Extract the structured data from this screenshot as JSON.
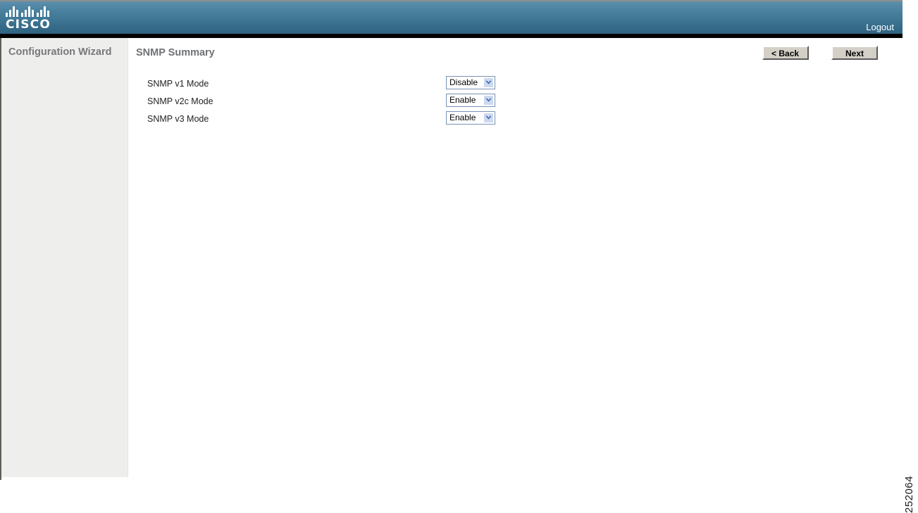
{
  "header": {
    "brand": "CISCO",
    "brand_logo_icon": "cisco-bars-icon",
    "logout_label": "Logout"
  },
  "sidebar": {
    "title": "Configuration Wizard"
  },
  "main": {
    "page_title": "SNMP Summary",
    "buttons": {
      "back_label": "< Back",
      "next_label": "Next"
    },
    "rows": [
      {
        "label": "SNMP v1 Mode",
        "value": "Disable",
        "arrow_icon": "chevron-down-icon"
      },
      {
        "label": "SNMP v2c Mode",
        "value": "Enable",
        "arrow_icon": "chevron-down-icon"
      },
      {
        "label": "SNMP v3 Mode",
        "value": "Enable",
        "arrow_icon": "chevron-down-icon"
      }
    ],
    "select_options": [
      "Enable",
      "Disable"
    ]
  },
  "watermark": {
    "text": "252064"
  },
  "colors": {
    "header_top": "#5d90ad",
    "header_bottom": "#2f6382",
    "sidebar_bg": "#eeeeec",
    "title_text": "#6f7174",
    "select_border": "#7a93b3",
    "select_arrow_bg": "#cdd9ef",
    "button_face": "#d4d0c8"
  }
}
